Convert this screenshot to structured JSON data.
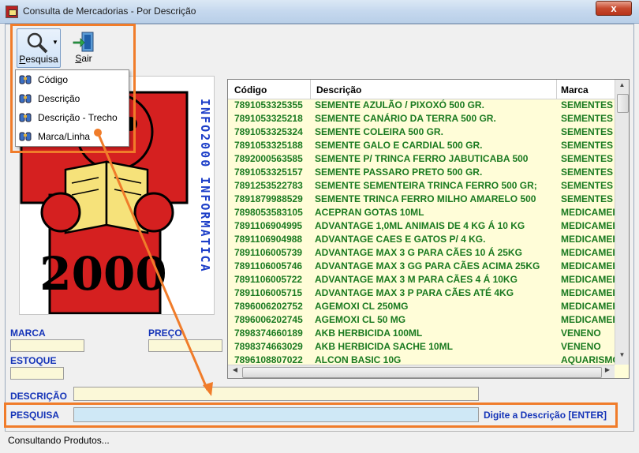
{
  "window": {
    "title": "Consulta de Mercadorias - Por Descrição",
    "close_glyph": "x"
  },
  "toolbar": {
    "search_label": "Pesquisa",
    "exit_label": "Sair"
  },
  "search_menu": {
    "items": [
      {
        "label": "Código",
        "icon": "binoculars-icon"
      },
      {
        "label": "Descrição",
        "icon": "binoculars-icon"
      },
      {
        "label": "Descrição - Trecho",
        "icon": "binoculars-icon"
      },
      {
        "label": "Marca/Linha",
        "icon": "binoculars-icon"
      }
    ]
  },
  "logo": {
    "vertical_text": "INFO2000 INFORMATICA",
    "big_text": "2000"
  },
  "form": {
    "marca_label": "MARCA",
    "marca_value": "",
    "preco_label": "PREÇO",
    "preco_value": "",
    "estoque_label": "ESTOQUE",
    "estoque_value": "",
    "descricao_label": "DESCRIÇÃO",
    "descricao_value": "",
    "pesquisa_label": "PESQUISA",
    "pesquisa_value": "",
    "hint": "Digite a Descrição [ENTER]"
  },
  "grid": {
    "headers": {
      "code": "Código",
      "desc": "Descrição",
      "brand": "Marca"
    },
    "rows": [
      {
        "code": "7891053325355",
        "desc": "  SEMENTE AZULÃO / PIXOXÓ 500 GR.",
        "brand": "SEMENTES"
      },
      {
        "code": "7891053325218",
        "desc": "  SEMENTE CANÁRIO DA TERRA 500 GR.",
        "brand": "SEMENTES"
      },
      {
        "code": "7891053325324",
        "desc": "  SEMENTE COLEIRA 500 GR.",
        "brand": "SEMENTES"
      },
      {
        "code": "7891053325188",
        "desc": "  SEMENTE GALO E CARDIAL 500 GR.",
        "brand": "SEMENTES"
      },
      {
        "code": "7892000563585",
        "desc": "  SEMENTE P/ TRINCA FERRO JABUTICABA 500",
        "brand": "SEMENTES"
      },
      {
        "code": "7891053325157",
        "desc": "  SEMENTE PASSARO PRETO 500 GR.",
        "brand": "SEMENTES"
      },
      {
        "code": "7891253522783",
        "desc": "  SEMENTE SEMENTEIRA TRINCA FERRO 500 GR;",
        "brand": "SEMENTES"
      },
      {
        "code": "7891879988529",
        "desc": "  SEMENTE TRINCA FERRO MILHO AMARELO 500",
        "brand": "SEMENTES"
      },
      {
        "code": "7898053583105",
        "desc": "ACEPRAN GOTAS 10ML",
        "brand": "MEDICAMEI"
      },
      {
        "code": "7891106904995",
        "desc": "ADVANTAGE  1,0ML ANIMAIS DE 4 KG Á 10 KG",
        "brand": "MEDICAMEI"
      },
      {
        "code": "7891106904988",
        "desc": "ADVANTAGE CAES E GATOS P/ 4 KG.",
        "brand": "MEDICAMEI"
      },
      {
        "code": "7891106005739",
        "desc": "ADVANTAGE MAX 3 G PARA CÃES 10 Á 25KG",
        "brand": "MEDICAMEI"
      },
      {
        "code": "7891106005746",
        "desc": "ADVANTAGE MAX 3 GG PARA CÃES ACIMA 25KG",
        "brand": "MEDICAMEI"
      },
      {
        "code": "7891106005722",
        "desc": "ADVANTAGE MAX 3 M PARA CÃES 4 Á 10KG",
        "brand": "MEDICAMEI"
      },
      {
        "code": "7891106005715",
        "desc": "ADVANTAGE MAX 3 P PARA CÃES ATÉ 4KG",
        "brand": "MEDICAMEI"
      },
      {
        "code": "7896006202752",
        "desc": "AGEMOXI CL 250MG",
        "brand": "MEDICAMEI"
      },
      {
        "code": "7896006202745",
        "desc": "AGEMOXI CL 50 MG",
        "brand": "MEDICAMEI"
      },
      {
        "code": "7898374660189",
        "desc": "AKB HERBICIDA 100ML",
        "brand": "VENENO"
      },
      {
        "code": "7898374663029",
        "desc": "AKB HERBICIDA SACHE 10ML",
        "brand": "VENENO"
      },
      {
        "code": "7896108807022",
        "desc": "ALCON BASIC 10G",
        "brand": "AQUARISMO"
      }
    ]
  },
  "status": {
    "text": "Consultando Produtos..."
  },
  "colors": {
    "highlight": "#f07c2a",
    "label_blue": "#1534b8",
    "row_text": "#1a7a20",
    "grid_bg": "#fffdd8"
  }
}
